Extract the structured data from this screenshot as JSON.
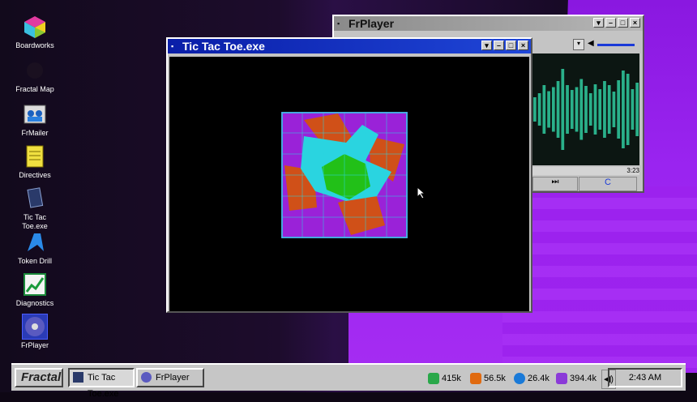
{
  "desktop_icons": [
    {
      "label": "Boardworks",
      "icon": "cube-icon"
    },
    {
      "label": "Fractal Map",
      "icon": "map-icon"
    },
    {
      "label": "FrMailer",
      "icon": "mail-people-icon"
    },
    {
      "label": "Directives",
      "icon": "notes-icon"
    },
    {
      "label": "Tic Tac Toe.exe",
      "icon": "program-icon"
    },
    {
      "label": "Token Drill",
      "icon": "drill-icon"
    },
    {
      "label": "Diagnostics",
      "icon": "chart-icon"
    },
    {
      "label": "FrPlayer",
      "icon": "disc-icon"
    }
  ],
  "game_window": {
    "title": "Tic Tac Toe.exe"
  },
  "player_window": {
    "title": "FrPlayer",
    "time": "3:23",
    "next_glyph": "⏭",
    "repeat_glyph": "C"
  },
  "taskbar": {
    "start_label": "Fractal",
    "tasks": [
      "Tic Tac Toe.exe",
      "FrPlayer"
    ],
    "tray": [
      {
        "value": "415k",
        "color": "#2aa84a"
      },
      {
        "value": "56.5k",
        "color": "#e06a10"
      },
      {
        "value": "26.4k",
        "color": "#1a7ad8"
      },
      {
        "value": "394.4k",
        "color": "#8b3ad8"
      }
    ],
    "clock": "2:43 AM"
  },
  "colors": {
    "title_active": "#0a1ea8",
    "cyan": "#2ad4e0",
    "orange": "#d05018",
    "green": "#22c018",
    "purple": "#9a22d8"
  }
}
